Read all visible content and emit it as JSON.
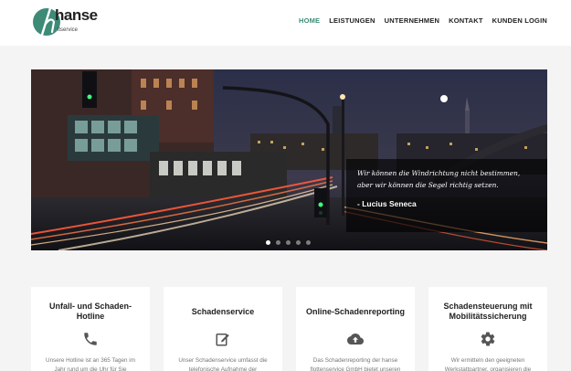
{
  "header": {
    "logo_text": "hanse",
    "logo_sub": "ltservice",
    "nav": [
      {
        "label": "HOME",
        "active": true
      },
      {
        "label": "LEISTUNGEN",
        "active": false
      },
      {
        "label": "UNTERNEHMEN",
        "active": false
      },
      {
        "label": "KONTAKT",
        "active": false
      },
      {
        "label": "KUNDEN LOGIN",
        "active": false
      }
    ],
    "accent_color": "#3d8b77"
  },
  "hero": {
    "quote_line1": "Wir können die Windrichtung nicht bestimmen,",
    "quote_line2": "aber wir können die Segel richtig setzen.",
    "author": "- Lucius Seneca",
    "slide_count": 5,
    "active_slide": 1
  },
  "cards": [
    {
      "title": "Unfall- und Schaden-Hotline",
      "icon": "phone-icon",
      "text": "Unsere Hotline ist an 365 Tagen im Jahr rund um die Uhr für Sie"
    },
    {
      "title": "Schadenservice",
      "icon": "edit-icon",
      "text": "Unser Schadenservice umfasst die telefonische Aufnahme der"
    },
    {
      "title": "Online-Schadenreporting",
      "icon": "cloud-upload-icon",
      "text": "Das Schadenreporting der hanse flottenservice GmbH bietet unseren"
    },
    {
      "title": "Schadensteuerung mit Mobilitätssicherung",
      "icon": "gear-icon",
      "text": "Wir ermitteln den geeigneten Werkstattpartner, organisieren die"
    }
  ]
}
